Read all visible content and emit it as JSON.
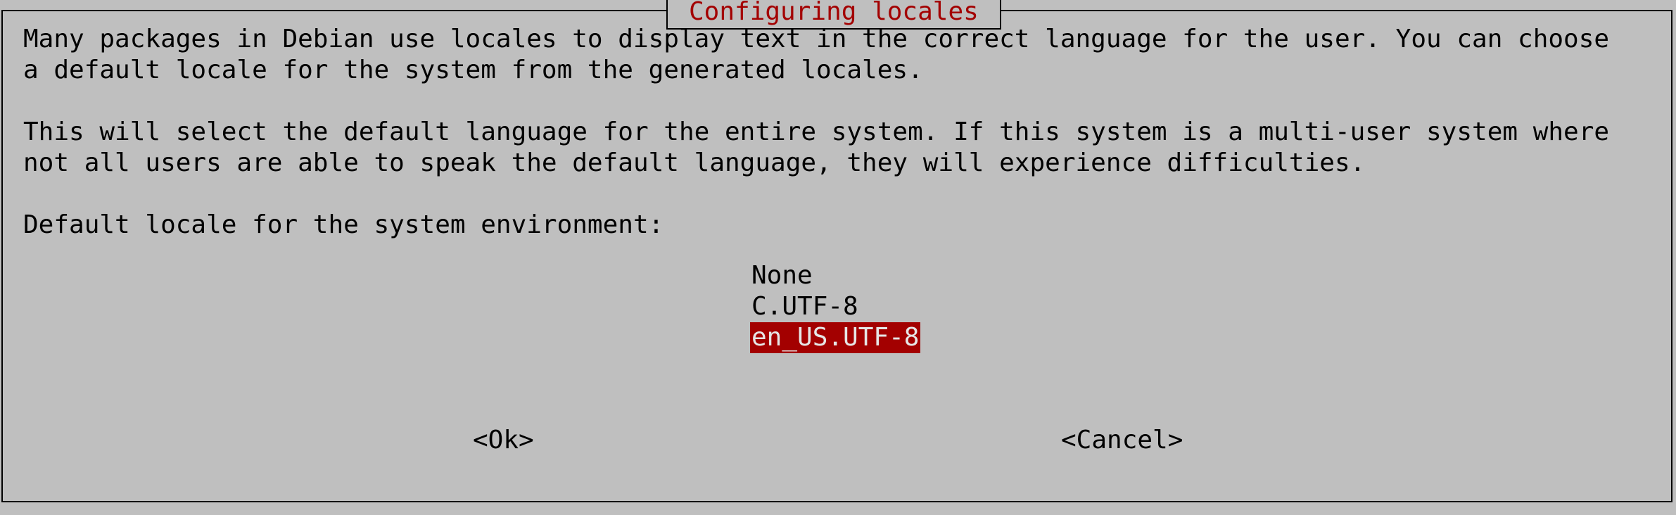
{
  "dialog": {
    "title": "Configuring locales",
    "paragraph1": [
      "Many packages in Debian use locales to display text in the correct language for the user. You can choose",
      "a default locale for the system from the generated locales."
    ],
    "paragraph2": [
      "This will select the default language for the entire system. If this system is a multi-user system where",
      "not all users are able to speak the default language, they will experience difficulties."
    ],
    "prompt": "Default locale for the system environment:",
    "locales": [
      "None",
      "C.UTF-8",
      "en_US.UTF-8"
    ],
    "selected_locale": "en_US.UTF-8",
    "buttons": {
      "ok": "<Ok>",
      "cancel": "<Cancel>"
    }
  },
  "colors": {
    "background": "#bfbfbf",
    "accent": "#a30000",
    "selected_text": "#e6e6e6",
    "text": "#000000"
  }
}
